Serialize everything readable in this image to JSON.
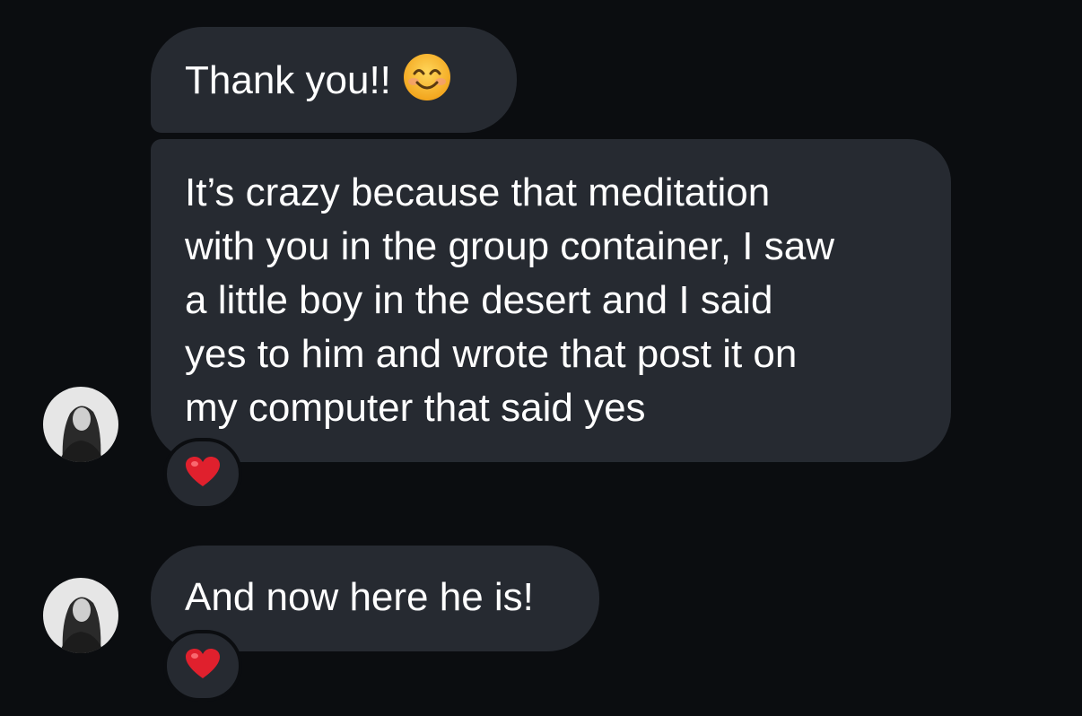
{
  "messages": [
    {
      "sender": "other",
      "text": "Thank you!!",
      "emoji": "smiling-face-icon"
    },
    {
      "sender": "other",
      "lines": [
        "It’s crazy because that meditation",
        "with you in the group container, I saw",
        "a little boy in the desert and I said",
        "yes to him and wrote that post it on",
        "my computer that said yes"
      ],
      "reaction": "red-heart-icon"
    },
    {
      "sender": "other",
      "text": "And now here he is!",
      "reaction": "red-heart-icon"
    }
  ],
  "colors": {
    "background": "#0b0d10",
    "bubble": "#262a31",
    "text": "#ffffff",
    "heart": "#e0202d",
    "emoji_face": "#f7b733"
  }
}
